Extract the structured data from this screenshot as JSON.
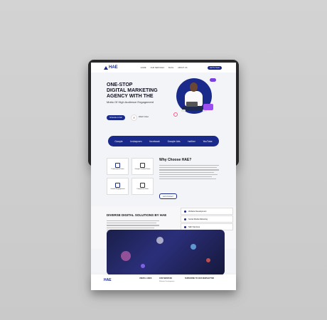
{
  "nav": {
    "logo": "HAE",
    "links": [
      "HOME",
      "OUR SERVICES",
      "BLOG",
      "ABOUT US"
    ],
    "call_label": "LET'S TALK"
  },
  "hero": {
    "title_line1": "ONE-STOP",
    "title_line2": "DIGITAL MARKETING",
    "title_line3": "AGENCY WITH THE",
    "subtitle": "Motto Of High Audience Engagement",
    "cta_label": "Schedule A Call",
    "watch_label": "Watch Video"
  },
  "brands": [
    "Google",
    "Instagram",
    "facebook",
    "Google Ads",
    "twitter",
    "YouTube"
  ],
  "features": [
    {
      "label": "Professional Team",
      "icon": "team-icon"
    },
    {
      "label": "Google Certified Team",
      "icon": "certified-icon"
    },
    {
      "label": "Growth Engagement",
      "icon": "growth-icon"
    },
    {
      "label": "Competitive Rate",
      "icon": "rate-icon"
    }
  ],
  "why": {
    "title": "Why Choose HAE?",
    "button_label": "Let's Connect"
  },
  "diverse": {
    "title": "DIVERSE DIGITAL SOLUTIONS BY HAE",
    "services": [
      "Website Development",
      "Social Media Marketing",
      "SEO Services"
    ]
  },
  "footer": {
    "logo": "HAE",
    "col1_title": "USEFUL LINKS",
    "col2_title": "OUR SERVICES",
    "col3_title": "SUBSCRIBE TO OUR NEWSLETTER",
    "col2_sub": "Website Development"
  },
  "colors": {
    "brand": "#1a2a8a",
    "accent_pink": "#ff5a8a",
    "accent_purple": "#9c4ef0"
  }
}
